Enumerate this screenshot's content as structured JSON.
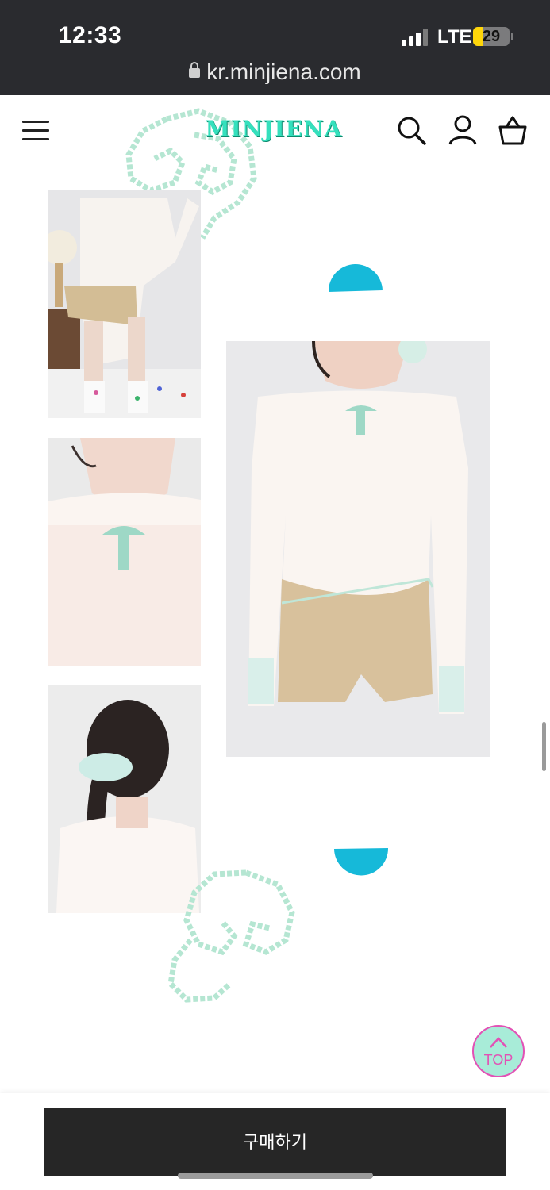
{
  "status_bar": {
    "time": "12:33",
    "network": "LTE",
    "battery": "29",
    "battery_level": 0.29
  },
  "browser": {
    "url": "kr.minjiena.com"
  },
  "header": {
    "logo": "MINJIENA"
  },
  "icons": {
    "menu": "menu-icon",
    "search": "search-icon",
    "account": "user-icon",
    "cart": "basket-icon",
    "lock": "lock-icon",
    "top": "arrow-up-icon"
  },
  "colors": {
    "brand": "#35e0bd",
    "accent_cyan": "#16b9d9",
    "top_border": "#e251b5",
    "top_fill": "#a8ecd8",
    "button_bg": "#262626"
  },
  "gallery": {
    "images": [
      {
        "name": "look-photo-full-body-side"
      },
      {
        "name": "look-photo-neckline-closeup"
      },
      {
        "name": "look-photo-back-with-scrunchie"
      },
      {
        "name": "look-photo-front-main"
      }
    ]
  },
  "actions": {
    "top_label": "TOP",
    "buy_label": "구매하기"
  }
}
